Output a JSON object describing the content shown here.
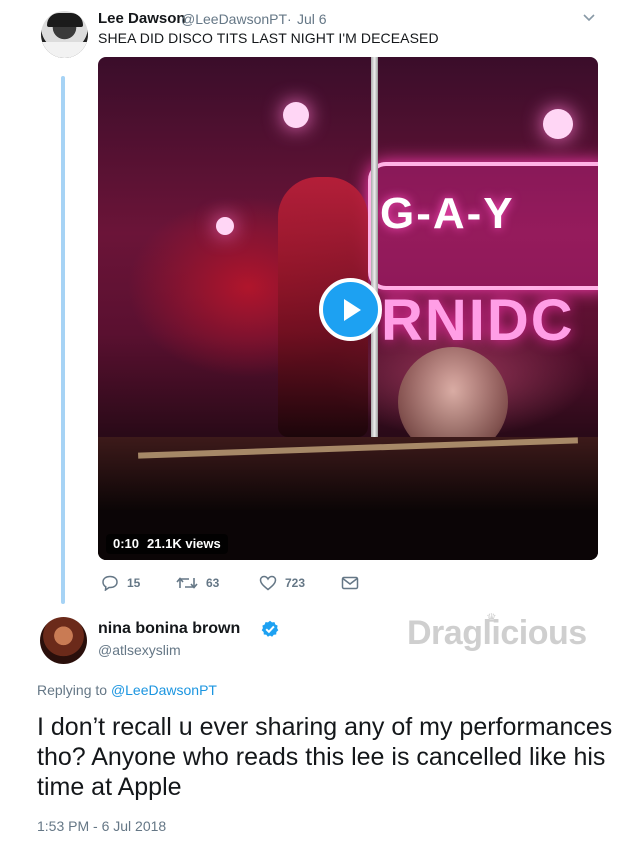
{
  "tweet1": {
    "name": "Lee Dawson",
    "handle": "@LeeDawsonPT",
    "separator": "·",
    "date": "Jul 6",
    "text": "SHEA DID DISCO TITS LAST NIGHT I'M DECEASED",
    "video": {
      "sign_text": "G-A-Y",
      "sign_text2": "RNIDC",
      "duration": "0:10",
      "views": "21.1K views"
    },
    "actions": {
      "replies": "15",
      "retweets": "63",
      "likes": "723"
    }
  },
  "tweet2": {
    "name": "nina bonina brown",
    "handle": "@atlsexyslim",
    "watermark": "Draglicious",
    "replying_prefix": "Replying to",
    "replying_to": "@LeeDawsonPT",
    "text": "I don’t recall u ever sharing any of my performances tho? Anyone who reads this lee is cancelled like his time at Apple",
    "timestamp": "1:53 PM - 6 Jul 2018"
  },
  "colors": {
    "accent": "#1da1f2",
    "thread_line": "#a6d3f5",
    "muted": "#657786"
  },
  "icons": [
    "reply-icon",
    "retweet-icon",
    "heart-icon",
    "envelope-icon",
    "play-icon",
    "verified-icon",
    "chevron-down-icon"
  ]
}
